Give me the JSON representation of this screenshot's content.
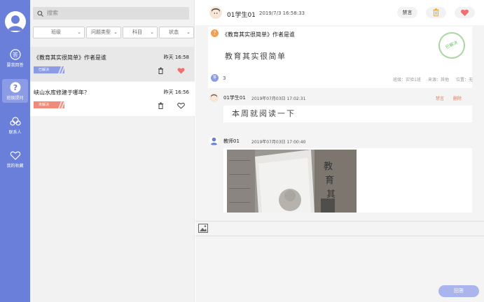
{
  "sidebar": {
    "items": [
      {
        "label": "要我回答",
        "icon": "answer-icon"
      },
      {
        "label": "班级提问",
        "icon": "question-icon"
      },
      {
        "label": "联系人",
        "icon": "contacts-icon"
      },
      {
        "label": "我的收藏",
        "icon": "heart-icon"
      }
    ],
    "active_index": 1,
    "colors": {
      "background": "#6a7fd9",
      "active": "#8c9be6"
    }
  },
  "search": {
    "placeholder": "搜索"
  },
  "filters": [
    "班级",
    "问题类型",
    "科目",
    "状态"
  ],
  "questions": [
    {
      "title": "《教育其实很简单》作者是谁",
      "time": "昨天 16:58",
      "status": "已解决",
      "status_color": "#8c9be6",
      "favorited": true
    },
    {
      "title": "峡山水库修建于哪年？",
      "time": "昨天 16:56",
      "status": "未解决",
      "status_color": "#f08a7a",
      "favorited": false
    }
  ],
  "detail": {
    "author": "01学生01",
    "date": "2019/7/3 16:58:33",
    "mute_label": "禁言",
    "question_title": "《教育其实很简单》作者是谁",
    "question_body": "教育其实很简单",
    "stamp_label": "已解决",
    "answer_count": "3",
    "answer_count_icon": "答",
    "meta": {
      "class": "班级：实验1班",
      "source": "来源：其他",
      "position": "位置：无"
    }
  },
  "replies": [
    {
      "name": "01学生01",
      "date": "2019年07月03日 17:02:31",
      "body": "本周就阅读一下",
      "mute": "禁言",
      "delete": "删除",
      "avatar": "student"
    },
    {
      "name": "教师01",
      "date": "2019年07月03日 17:00:40",
      "avatar": "teacher",
      "has_image": true
    }
  ],
  "answer_button": "回答"
}
